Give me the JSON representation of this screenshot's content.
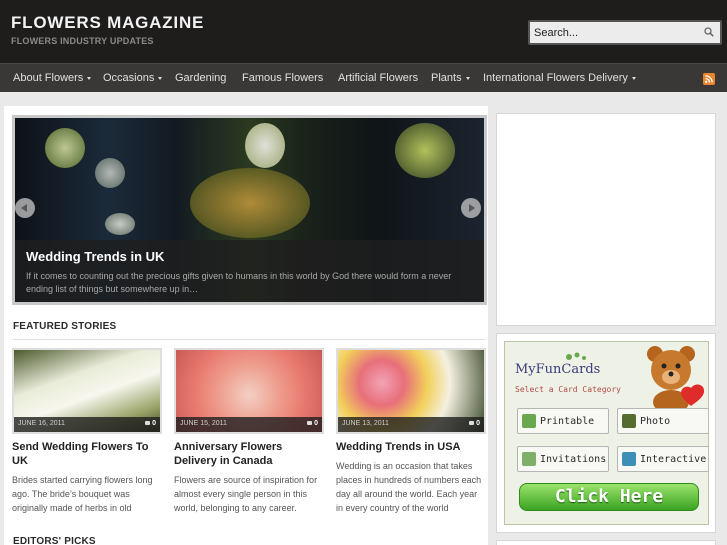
{
  "header": {
    "title": "FLOWERS MAGAZINE",
    "subtitle": "FLOWERS INDUSTRY UPDATES",
    "search_placeholder": "Search..."
  },
  "nav": {
    "items": [
      {
        "label": "About Flowers",
        "dropdown": true
      },
      {
        "label": "Occasions",
        "dropdown": true
      },
      {
        "label": "Gardening",
        "dropdown": false
      },
      {
        "label": "Famous Flowers",
        "dropdown": false
      },
      {
        "label": "Artificial Flowers",
        "dropdown": false
      },
      {
        "label": "Plants",
        "dropdown": true
      },
      {
        "label": "International Flowers Delivery",
        "dropdown": true
      }
    ]
  },
  "slider": {
    "title": "Wedding Trends in UK",
    "excerpt": "If it comes to counting out the precious gifts given to humans in this world by God there would form a never ending list of things but somewhere up in…"
  },
  "featured": {
    "heading": "FEATURED STORIES",
    "cards": [
      {
        "date": "JUNE 16, 2011",
        "comments": "0",
        "title": "Send Wedding Flowers To UK",
        "excerpt": "Brides started carrying flowers long ago. The bride’s bouquet was originally made of herbs in old"
      },
      {
        "date": "JUNE 15, 2011",
        "comments": "0",
        "title": "Anniversary Flowers Delivery in Canada",
        "excerpt": "Flowers are source of inspiration for almost every single person in this world, belonging to any career."
      },
      {
        "date": "JUNE 13, 2011",
        "comments": "0",
        "title": "Wedding Trends in USA",
        "excerpt": "Wedding is an occasion that takes places in hundreds of numbers each day all around the world. Each year in every country of the world"
      }
    ]
  },
  "editors": {
    "heading": "EDITORS' PICKS"
  },
  "ad": {
    "brand": "MyFunCards",
    "tagline": "Select a Card Category",
    "buttons": [
      "Printable",
      "Photo",
      "Invitations",
      "Interactive"
    ],
    "cta": "Click Here"
  },
  "colors": {
    "header_bg": "#1f1d1c",
    "nav_bg": "#393837",
    "page_bg": "#e9e9e9",
    "rss": "#e8842c",
    "cta_green": "#3aa321"
  },
  "icons": [
    "search-icon",
    "rss-icon",
    "comment-icon",
    "arrow-left-icon",
    "arrow-right-icon"
  ]
}
